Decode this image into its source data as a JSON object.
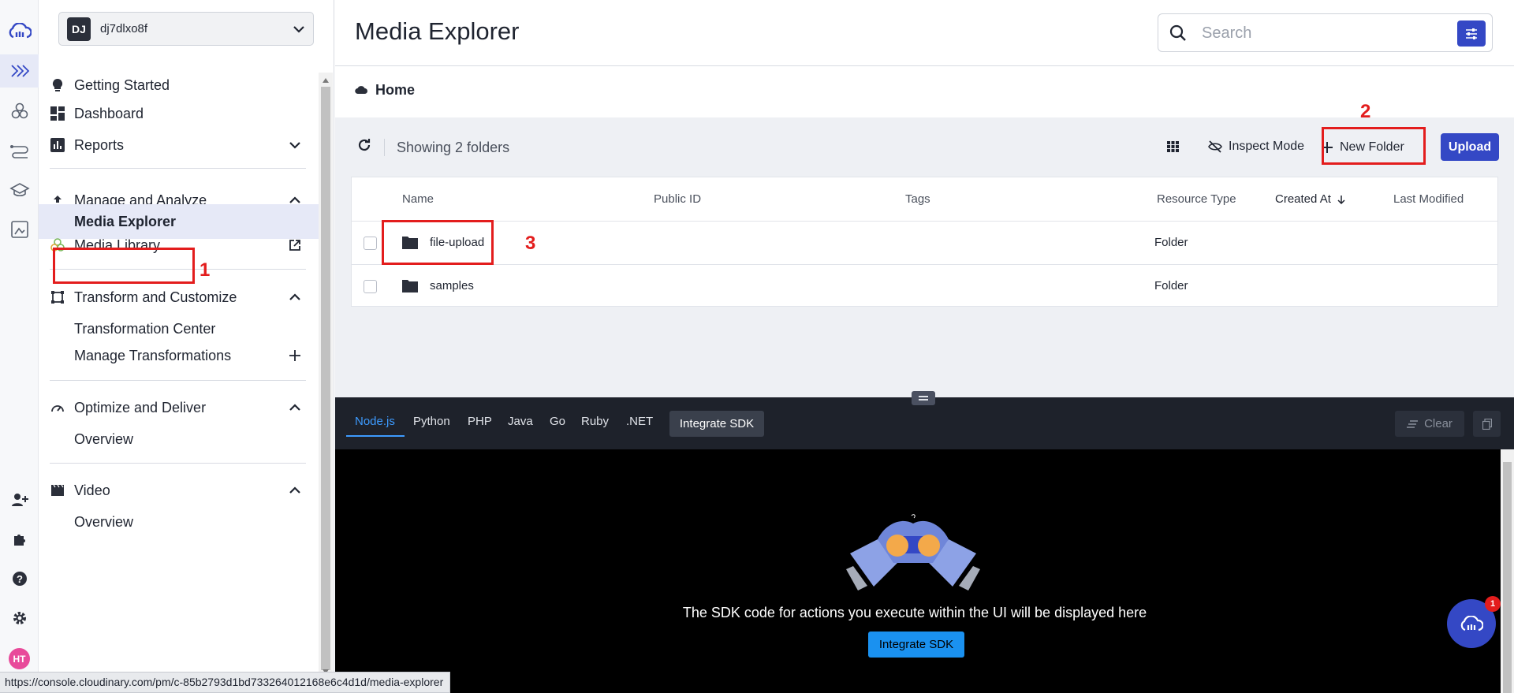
{
  "cloud": {
    "badge": "DJ",
    "name": "dj7dlxo8f"
  },
  "sidebar": {
    "items": [
      {
        "label": "Getting Started"
      },
      {
        "label": "Dashboard"
      },
      {
        "label": "Reports"
      },
      {
        "label": "Manage and Analyze"
      },
      {
        "label": "Media Explorer"
      },
      {
        "label": "Media Library"
      },
      {
        "label": "Transform and Customize"
      },
      {
        "label": "Transformation Center"
      },
      {
        "label": "Manage Transformations"
      },
      {
        "label": "Optimize and Deliver"
      },
      {
        "label": "Overview"
      },
      {
        "label": "Video"
      },
      {
        "label": "Overview"
      }
    ]
  },
  "rail": {
    "avatar": "HT"
  },
  "header": {
    "title": "Media Explorer",
    "search_placeholder": "Search"
  },
  "breadcrumb": {
    "label": "Home"
  },
  "toolbar": {
    "showing": "Showing 2 folders",
    "inspect_label": "Inspect Mode",
    "new_folder_label": "New Folder",
    "upload_label": "Upload"
  },
  "table": {
    "columns": [
      "Name",
      "Public ID",
      "Tags",
      "Resource Type",
      "Created At",
      "Last Modified"
    ],
    "rows": [
      {
        "name": "file-upload",
        "type": "Folder"
      },
      {
        "name": "samples",
        "type": "Folder"
      }
    ]
  },
  "sdk": {
    "languages": [
      "Node.js",
      "Python",
      "PHP",
      "Java",
      "Go",
      "Ruby",
      ".NET"
    ],
    "active_language": "Node.js",
    "integrate_label": "Integrate SDK",
    "clear_label": "Clear",
    "message": "The SDK code for actions you execute within the UI will be displayed here",
    "cta_label": "Integrate SDK"
  },
  "annotations": {
    "a1": "1",
    "a2": "2",
    "a3": "3"
  },
  "chat": {
    "badge": "1"
  },
  "status_url": "https://console.cloudinary.com/pm/c-85b2793d1bd733264012168e6c4d1d/media-explorer",
  "colors": {
    "accent": "#3448c5",
    "annotation": "#e31d1d",
    "sdk_link": "#3d9bff"
  }
}
